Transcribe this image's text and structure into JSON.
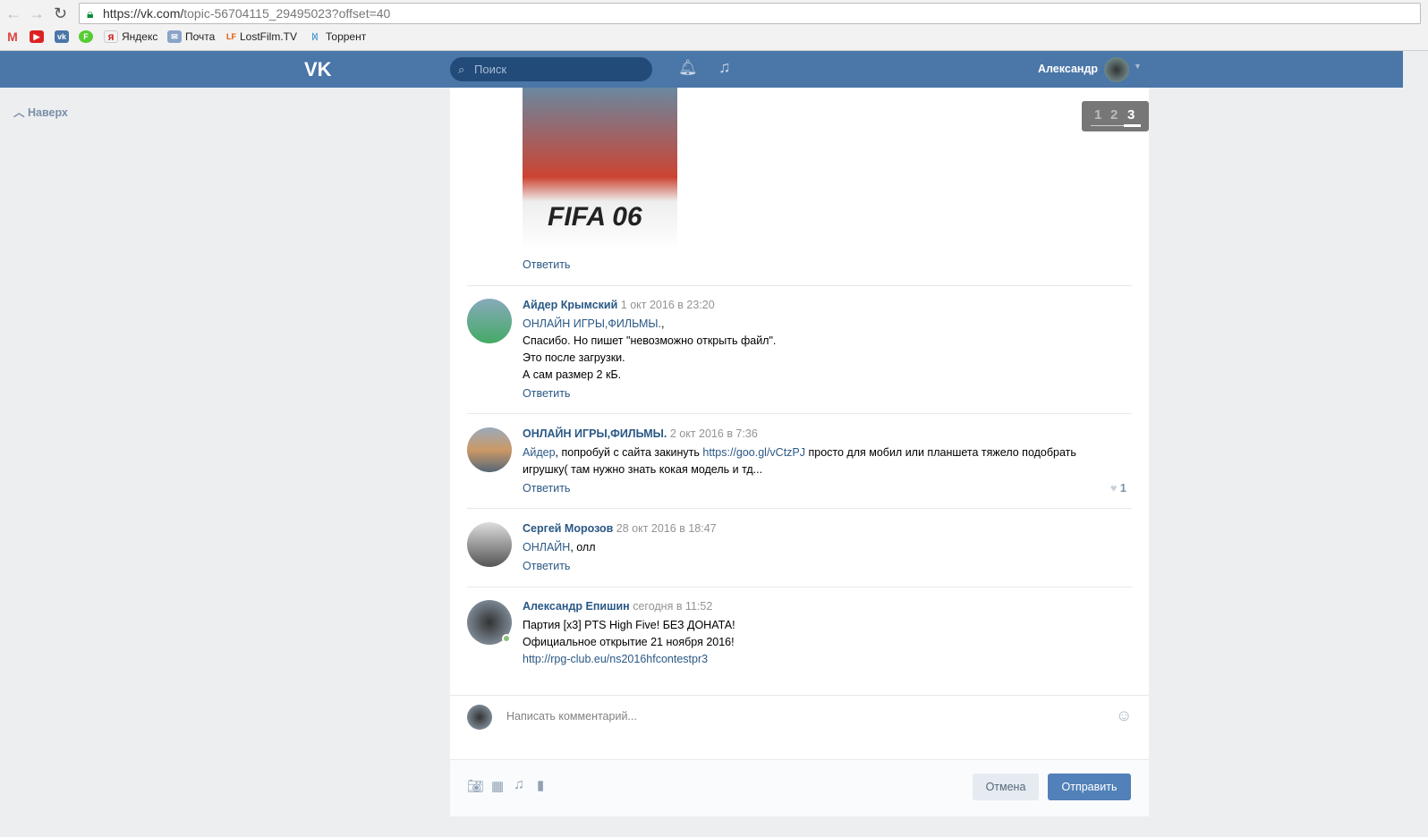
{
  "browser": {
    "url_host": "https://vk.com/",
    "url_path": "topic-56704115_29495023?offset=40",
    "bookmarks": [
      {
        "label": "",
        "icon": "gmail-icon"
      },
      {
        "label": "",
        "icon": "youtube-icon"
      },
      {
        "label": "",
        "icon": "vk-icon"
      },
      {
        "label": "",
        "icon": "f-icon"
      },
      {
        "label": "Яндекс",
        "icon": "yandex-icon"
      },
      {
        "label": "Почта",
        "icon": "mail-icon"
      },
      {
        "label": "LostFilm.TV",
        "icon": "lostfilm-icon"
      },
      {
        "label": "Торрент",
        "icon": "butterfly-icon"
      }
    ]
  },
  "header": {
    "search_placeholder": "Поиск",
    "user_name": "Александр"
  },
  "sidebar": {
    "back_to_top": "Наверх"
  },
  "pager": {
    "pages": [
      "1",
      "2",
      "3"
    ],
    "current": "3"
  },
  "post_image": {
    "caption": "FIFA 06",
    "reply": "Ответить"
  },
  "comments": [
    {
      "author": "Айдер Крымский",
      "date": "1 окт 2016 в 23:20",
      "lines": [
        {
          "mention": "ОНЛАЙН ИГРЫ,ФИЛЬМЫ.",
          "text": ","
        },
        {
          "text": "Спасибо. Но пишет \"невозможно открыть файл\"."
        },
        {
          "text": "Это после загрузки."
        },
        {
          "text": "А сам размер 2 кБ."
        }
      ],
      "reply": "Ответить"
    },
    {
      "author": "ОНЛАЙН ИГРЫ,ФИЛЬМЫ.",
      "date": "2 окт 2016 в 7:36",
      "mention": "Айдер",
      "text1": ", попробуй с сайта закинуть ",
      "link": "https://goo.gl/vCtzPJ",
      "text2": " просто для мобил или планшета тяжело подобрать",
      "text3": "игрушку( там нужно знать кокая модель и тд...",
      "reply": "Ответить",
      "likes": "1"
    },
    {
      "author": "Сергей Морозов",
      "date": "28 окт 2016 в 18:47",
      "mention": "ОНЛАЙН",
      "text": ", олл",
      "reply": "Ответить"
    },
    {
      "author": "Александр Епишин",
      "date": "сегодня в 11:52",
      "lines": [
        "Партия [x3] PTS High Five! БЕЗ ДОНАТА!",
        "Официальное открытие 21 ноября 2016!"
      ],
      "link": "http://rpg-club.eu/ns2016hfcontestpr3"
    }
  ],
  "composer": {
    "placeholder": "Написать комментарий...",
    "cancel": "Отмена",
    "send": "Отправить"
  },
  "colors": {
    "header": "#4a76a8",
    "link": "#2a5885",
    "button": "#5181b8"
  }
}
